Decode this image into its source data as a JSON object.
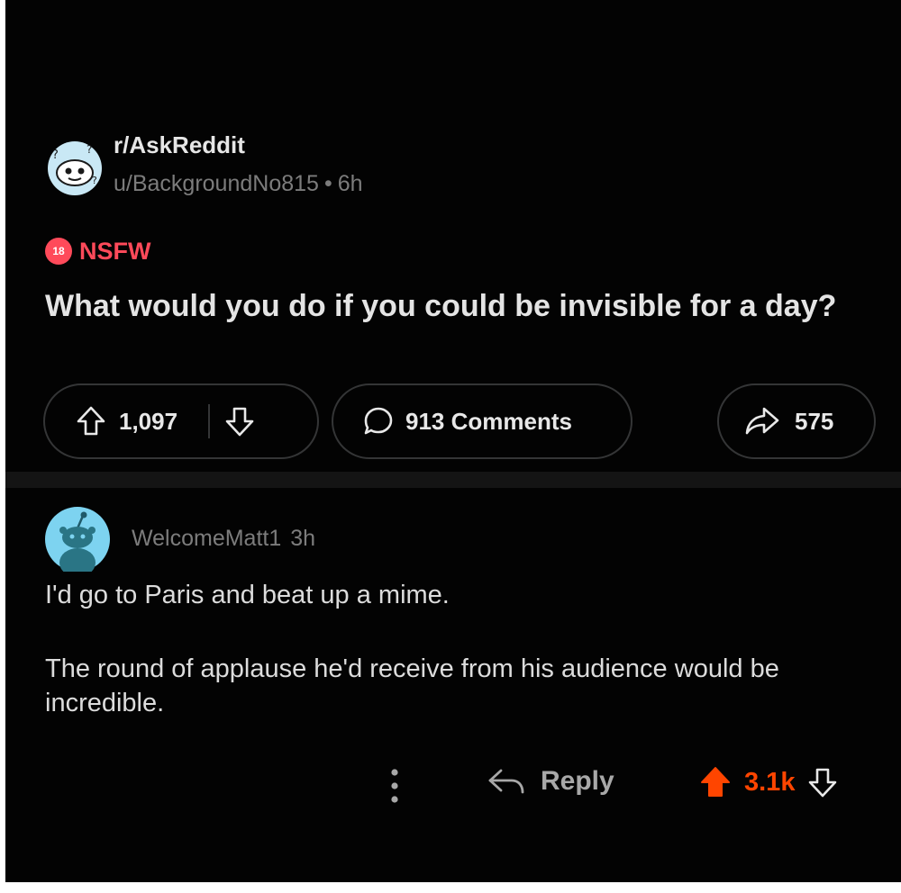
{
  "post": {
    "subreddit": "r/AskReddit",
    "author": "u/BackgroundNo815",
    "separator": "•",
    "age": "6h",
    "nsfw_badge": "18",
    "nsfw_label": "NSFW",
    "title": "What would you do if you could be invisible for a day?",
    "upvotes": "1,097",
    "comments_label": "913 Comments",
    "shares": "575"
  },
  "comment": {
    "author": "WelcomeMatt1",
    "age": "3h",
    "paragraphs": [
      "I'd go to Paris and beat up a mime.",
      "The round of applause he'd receive from his audience would be incredible."
    ],
    "reply_label": "Reply",
    "score": "3.1k"
  },
  "icons": {
    "subreddit_avatar": "askreddit-snoo-icon",
    "upvote": "arrow-up-outline-icon",
    "downvote": "arrow-down-outline-icon",
    "comments": "speech-bubble-icon",
    "share": "share-arrow-icon",
    "user_avatar": "snoo-avatar-icon",
    "more": "vertical-dots-icon",
    "reply": "reply-arrow-icon",
    "upvoted": "arrow-up-filled-icon"
  },
  "colors": {
    "background": "#030303",
    "nsfw": "#ff4a5a",
    "upvoted": "#ff4500",
    "pill_border": "#343536",
    "avatar_bg": "#7dd3f0"
  }
}
